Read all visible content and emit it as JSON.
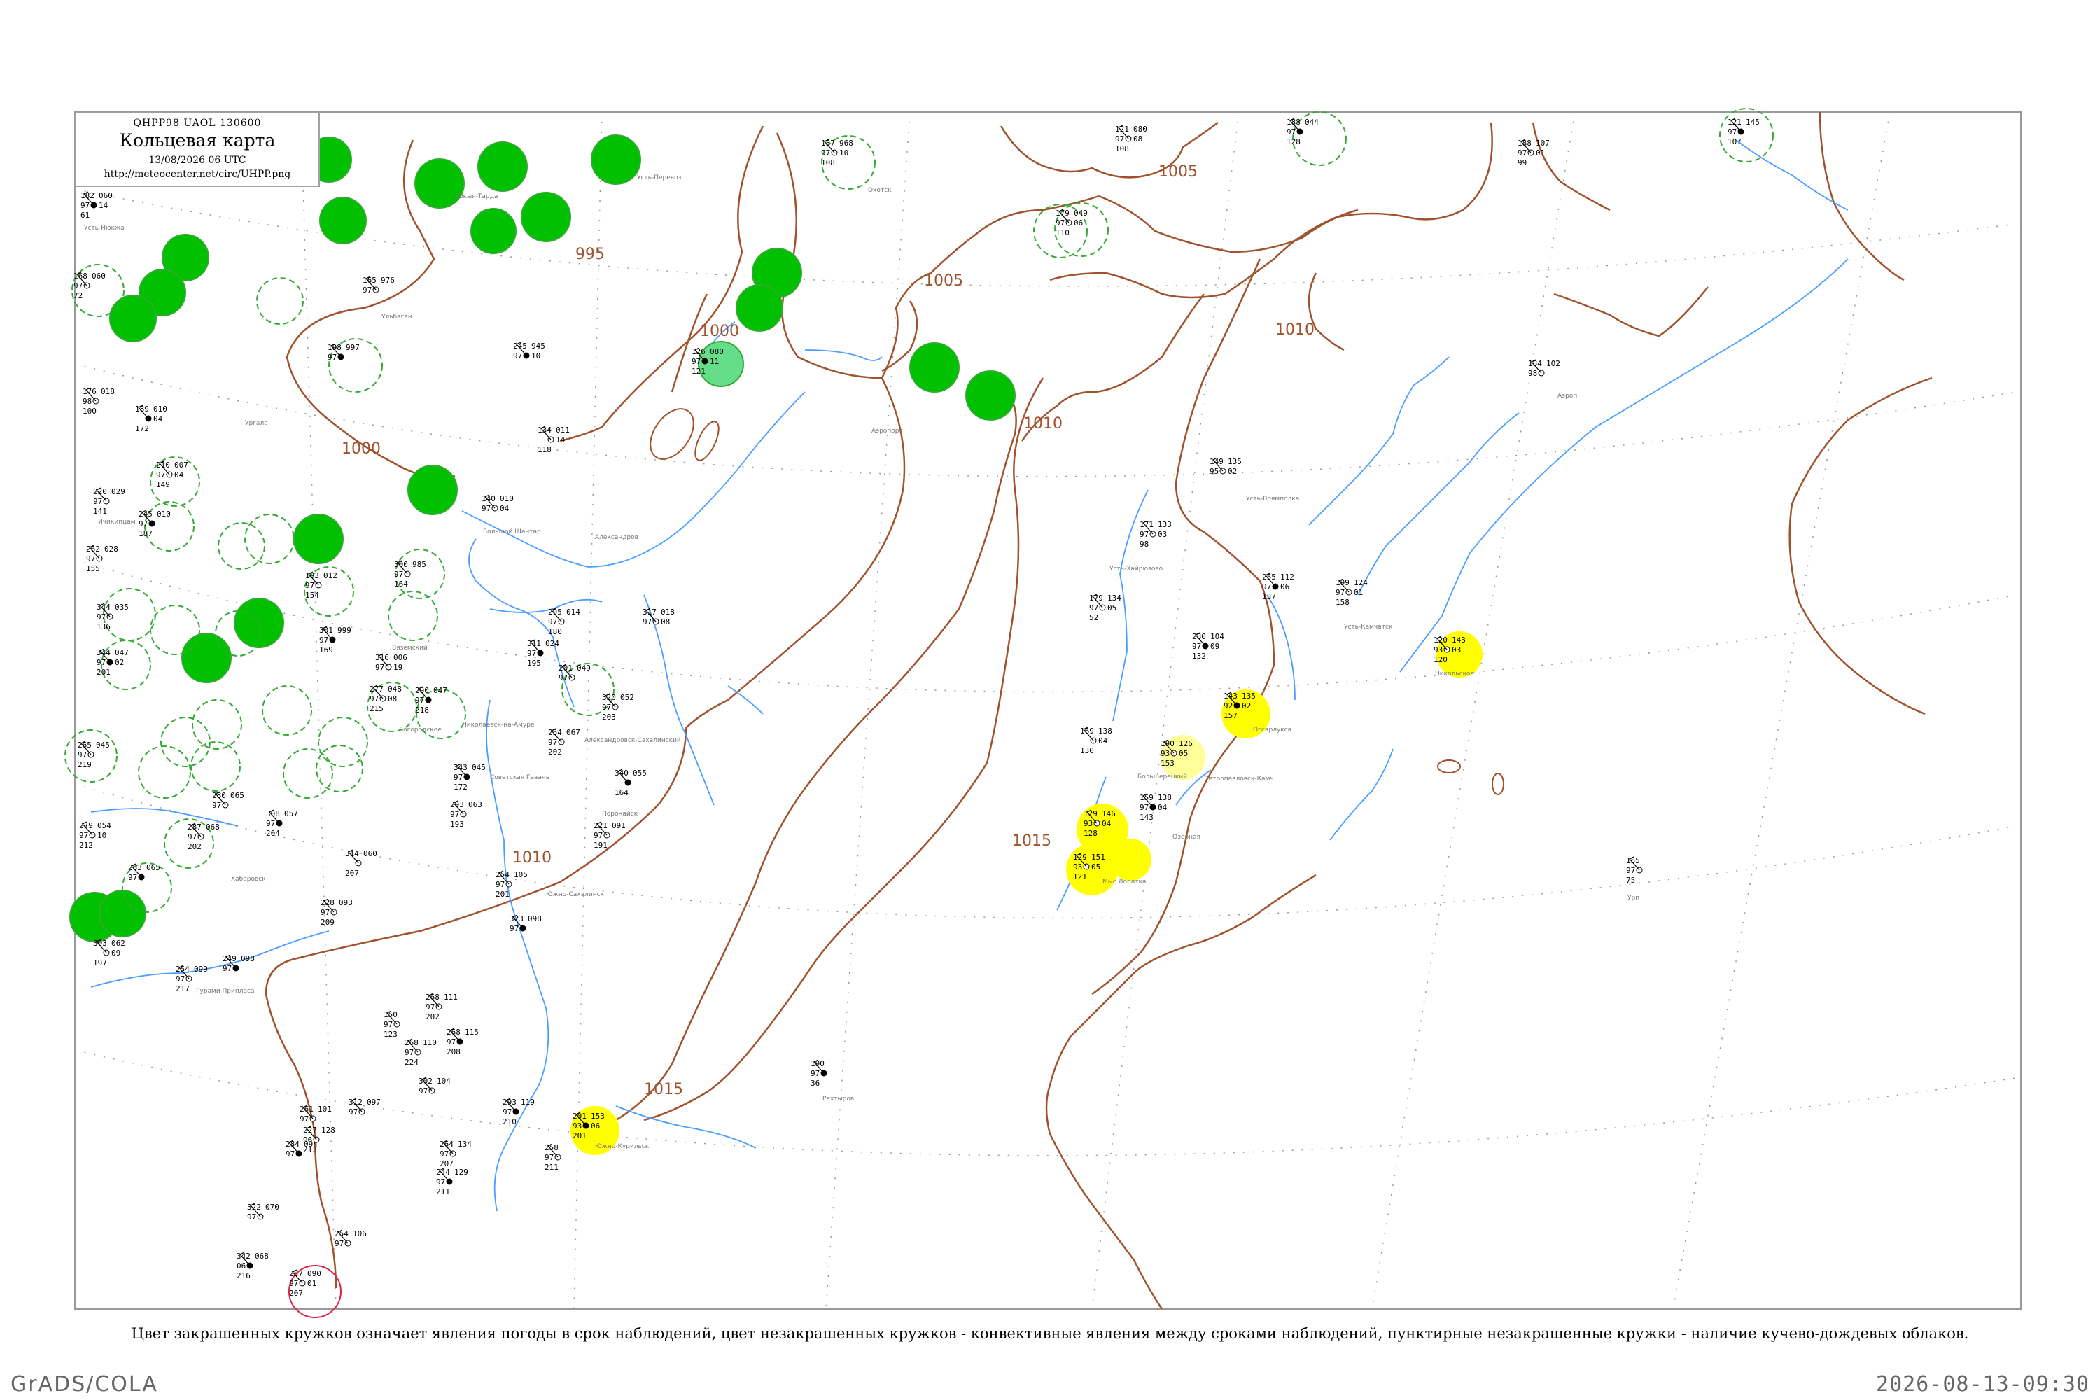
{
  "header": {
    "code": "QHPP98  UAOL  130600",
    "title": "Кольцевая карта",
    "datetime": "13/08/2026 06 UTC",
    "url": "http://meteocenter.net/circ/UHPP.png"
  },
  "caption": "Цвет закрашенных кружков означает явления погоды в срок наблюдений, цвет незакрашенных кружков - конвективные явления между сроками наблюдений, пунктирные незакрашенные кружки - наличие кучево-дождевых облаков.",
  "footer": {
    "left": "GrADS/COLA",
    "right": "2026-08-13-09:30"
  },
  "colors": {
    "rain_green": "#00c000",
    "shower_light_green": "#66dd88",
    "fog_yellow": "#ffff00",
    "haze_light_yellow": "#ffff99",
    "cb_dashed_green": "#33aa33",
    "thunder_red": "#dd2244",
    "coast": "#a0522d",
    "rivers": "#4a9eff",
    "isobar_label": "#a0522d"
  },
  "isobars": [
    "995",
    "1000",
    "1000",
    "1005",
    "1005",
    "1010",
    "1010",
    "1010",
    "1015",
    "1015"
  ],
  "stations": [
    {
      "p": "182",
      "t": "060",
      "dp": "14",
      "v": "97",
      "w": "61",
      "id": "",
      "name": ""
    },
    {
      "p": "168",
      "t": "060",
      "dp": "",
      "v": "97",
      "w": "72",
      "id": "",
      "name": ""
    },
    {
      "p": "176",
      "t": "018",
      "dp": "",
      "v": "98",
      "w": "100",
      "id": "",
      "name": ""
    },
    {
      "p": "189",
      "t": "010",
      "dp": "04",
      "v": "",
      "w": "172",
      "id": "",
      "name": ""
    },
    {
      "p": "210",
      "t": "007",
      "dp": "04",
      "v": "97",
      "w": "149",
      "id": "",
      "name": ""
    },
    {
      "p": "220",
      "t": "029",
      "dp": "",
      "v": "97",
      "w": "141",
      "id": "31442",
      "name": ""
    },
    {
      "p": "245",
      "t": "010",
      "dp": "",
      "v": "97",
      "w": "187",
      "id": "",
      "name": ""
    },
    {
      "p": "262",
      "t": "028",
      "dp": "",
      "v": "97",
      "w": "155",
      "id": "",
      "name": ""
    },
    {
      "p": "344",
      "t": "035",
      "dp": "",
      "v": "97",
      "w": "136",
      "id": "",
      "name": ""
    },
    {
      "p": "344",
      "t": "047",
      "dp": "02",
      "v": "97",
      "w": "201",
      "id": "",
      "name": ""
    },
    {
      "p": "265",
      "t": "045",
      "dp": "",
      "v": "97",
      "w": "219",
      "id": "",
      "name": ""
    },
    {
      "p": "279",
      "t": "054",
      "dp": "10",
      "v": "97",
      "w": "212",
      "id": "",
      "name": ""
    },
    {
      "p": "283",
      "t": "065",
      "dp": "",
      "v": "97",
      "w": "",
      "id": "",
      "name": ""
    },
    {
      "p": "303",
      "t": "062",
      "dp": "09",
      "v": "",
      "w": "197",
      "id": "",
      "name": ""
    },
    {
      "p": "254",
      "t": "099",
      "dp": "",
      "v": "97",
      "w": "217",
      "id": "",
      "name": ""
    },
    {
      "p": "249",
      "t": "098",
      "dp": "",
      "v": "97",
      "w": "",
      "id": "",
      "name": ""
    },
    {
      "p": "228",
      "t": "093",
      "dp": "",
      "v": "97",
      "w": "209",
      "id": "",
      "name": ""
    },
    {
      "p": "165",
      "t": "976",
      "dp": "",
      "v": "97",
      "w": "",
      "id": "",
      "name": ""
    },
    {
      "p": "198",
      "t": "997",
      "dp": "",
      "v": "97",
      "w": "",
      "id": "",
      "name": ""
    },
    {
      "p": "140",
      "t": "010",
      "dp": "04",
      "v": "97",
      "w": "",
      "id": "",
      "name": ""
    },
    {
      "p": "134",
      "t": "011",
      "dp": "14",
      "v": "",
      "w": "118",
      "id": "",
      "name": ""
    },
    {
      "p": "245",
      "t": "945",
      "dp": "10",
      "v": "97",
      "w": "",
      "id": "",
      "name": ""
    },
    {
      "p": "300",
      "t": "985",
      "dp": "",
      "v": "97",
      "w": "164",
      "id": "",
      "name": ""
    },
    {
      "p": "193",
      "t": "012",
      "dp": "",
      "v": "97",
      "w": "154",
      "id": "",
      "name": ""
    },
    {
      "p": "301",
      "t": "999",
      "dp": "",
      "v": "97",
      "w": "169",
      "id": "",
      "name": ""
    },
    {
      "p": "316",
      "t": "006",
      "dp": "19",
      "v": "97",
      "w": "",
      "id": "",
      "name": ""
    },
    {
      "p": "277",
      "t": "048",
      "dp": "08",
      "v": "97",
      "w": "215",
      "id": "",
      "name": ""
    },
    {
      "p": "290",
      "t": "047",
      "dp": "",
      "v": "97",
      "w": "218",
      "id": "",
      "name": ""
    },
    {
      "p": "295",
      "t": "014",
      "dp": "",
      "v": "97",
      "w": "180",
      "id": "",
      "name": ""
    },
    {
      "p": "317",
      "t": "018",
      "dp": "08",
      "v": "97",
      "w": "",
      "id": "",
      "name": ""
    },
    {
      "p": "311",
      "t": "024",
      "dp": "",
      "v": "97",
      "w": "195",
      "id": "",
      "name": ""
    },
    {
      "p": "320",
      "t": "052",
      "dp": "",
      "v": "97",
      "w": "203",
      "id": "",
      "name": ""
    },
    {
      "p": "254",
      "t": "067",
      "dp": "",
      "v": "97",
      "w": "202",
      "id": "",
      "name": ""
    },
    {
      "p": "343",
      "t": "045",
      "dp": "",
      "v": "97",
      "w": "172",
      "id": "",
      "name": ""
    },
    {
      "p": "293",
      "t": "063",
      "dp": "",
      "v": "97",
      "w": "193",
      "id": "",
      "name": ""
    },
    {
      "p": "280",
      "t": "065",
      "dp": "",
      "v": "97",
      "w": "",
      "id": "",
      "name": ""
    },
    {
      "p": "308",
      "t": "057",
      "dp": "",
      "v": "97",
      "w": "204",
      "id": "",
      "name": ""
    },
    {
      "p": "287",
      "t": "068",
      "dp": "",
      "v": "97",
      "w": "202",
      "id": "",
      "name": ""
    },
    {
      "p": "221",
      "t": "091",
      "dp": "",
      "v": "97",
      "w": "191",
      "id": "",
      "name": ""
    },
    {
      "p": "340",
      "t": "055",
      "dp": "",
      "v": "",
      "w": "164",
      "id": "",
      "name": ""
    },
    {
      "p": "314",
      "t": "060",
      "dp": "",
      "v": "",
      "w": "207",
      "id": "",
      "name": ""
    },
    {
      "p": "254",
      "t": "105",
      "dp": "",
      "v": "97",
      "w": "201",
      "id": "",
      "name": ""
    },
    {
      "p": "323",
      "t": "098",
      "dp": "",
      "v": "97",
      "w": "",
      "id": "",
      "name": ""
    },
    {
      "p": "268",
      "t": "111",
      "dp": "",
      "v": "97",
      "w": "202",
      "id": "",
      "name": ""
    },
    {
      "p": "150",
      "t": "",
      "dp": "",
      "v": "97",
      "w": "123",
      "id": "",
      "name": ""
    },
    {
      "p": "268",
      "t": "115",
      "dp": "",
      "v": "97",
      "w": "208",
      "id": "",
      "name": ""
    },
    {
      "p": "268",
      "t": "110",
      "dp": "",
      "v": "97",
      "w": "224",
      "id": "",
      "name": ""
    },
    {
      "p": "302",
      "t": "104",
      "dp": "",
      "v": "97",
      "w": "",
      "id": "",
      "name": ""
    },
    {
      "p": "293",
      "t": "119",
      "dp": "",
      "v": "97",
      "w": "210",
      "id": "",
      "name": ""
    },
    {
      "p": "261",
      "t": "101",
      "dp": "",
      "v": "97",
      "w": "",
      "id": "",
      "name": ""
    },
    {
      "p": "312",
      "t": "097",
      "dp": "",
      "v": "97",
      "w": "",
      "id": "",
      "name": ""
    },
    {
      "p": "284",
      "t": "094",
      "dp": "",
      "v": "97",
      "w": "",
      "id": "",
      "name": ""
    },
    {
      "p": "227",
      "t": "128",
      "dp": "",
      "v": "96",
      "w": "213",
      "id": "",
      "name": ""
    },
    {
      "p": "264",
      "t": "134",
      "dp": "",
      "v": "97",
      "w": "207",
      "id": "",
      "name": ""
    },
    {
      "p": "244",
      "t": "129",
      "dp": "",
      "v": "97",
      "w": "211",
      "id": "",
      "name": ""
    },
    {
      "p": "258",
      "t": "",
      "dp": "",
      "v": "97",
      "w": "211",
      "id": "",
      "name": ""
    },
    {
      "p": "322",
      "t": "070",
      "dp": "",
      "v": "97",
      "w": "",
      "id": "",
      "name": ""
    },
    {
      "p": "342",
      "t": "068",
      "dp": "",
      "v": "06",
      "w": "216",
      "id": "",
      "name": ""
    },
    {
      "p": "257",
      "t": "090",
      "dp": "01",
      "v": "97",
      "w": "207",
      "id": "",
      "name": ""
    },
    {
      "p": "254",
      "t": "106",
      "dp": "",
      "v": "97",
      "w": "",
      "id": "",
      "name": ""
    },
    {
      "p": "190",
      "t": "",
      "dp": "",
      "v": "97",
      "w": "36",
      "id": "",
      "name": ""
    },
    {
      "p": "187",
      "t": "968",
      "dp": "10",
      "v": "97",
      "w": "108",
      "id": "",
      "name": ""
    },
    {
      "p": "121",
      "t": "080",
      "dp": "08",
      "v": "97",
      "w": "108",
      "id": "",
      "name": ""
    },
    {
      "p": "188",
      "t": "044",
      "dp": "",
      "v": "97",
      "w": "128",
      "id": "",
      "name": ""
    },
    {
      "p": "179",
      "t": "049",
      "dp": "06",
      "v": "97",
      "w": "110",
      "id": "",
      "name": ""
    },
    {
      "p": "188",
      "t": "107",
      "dp": "01",
      "v": "97",
      "w": "99",
      "id": "",
      "name": ""
    },
    {
      "p": "121",
      "t": "145",
      "dp": "",
      "v": "97",
      "w": "107",
      "id": "",
      "name": ""
    },
    {
      "p": "149",
      "t": "135",
      "dp": "02",
      "v": "95",
      "w": "",
      "id": "",
      "name": ""
    },
    {
      "p": "171",
      "t": "133",
      "dp": "03",
      "v": "97",
      "w": "98",
      "id": "",
      "name": ""
    },
    {
      "p": "255",
      "t": "112",
      "dp": "06",
      "v": "97",
      "w": "137",
      "id": "",
      "name": ""
    },
    {
      "p": "199",
      "t": "124",
      "dp": "01",
      "v": "97",
      "w": "158",
      "id": "",
      "name": ""
    },
    {
      "p": "179",
      "t": "134",
      "dp": "05",
      "v": "97",
      "w": "52",
      "id": "",
      "name": ""
    },
    {
      "p": "280",
      "t": "104",
      "dp": "09",
      "v": "97",
      "w": "132",
      "id": "",
      "name": ""
    },
    {
      "p": "184",
      "t": "102",
      "dp": "",
      "v": "98",
      "w": "",
      "id": "",
      "name": ""
    },
    {
      "p": "169",
      "t": "138",
      "dp": "04",
      "v": "",
      "w": "130",
      "id": "",
      "name": ""
    },
    {
      "p": "159",
      "t": "138",
      "dp": "04",
      "v": "97",
      "w": "143",
      "id": "",
      "name": ""
    },
    {
      "p": "155",
      "t": "",
      "dp": "",
      "v": "97",
      "w": "75",
      "id": "",
      "name": ""
    },
    {
      "p": "201",
      "t": "049",
      "dp": "",
      "v": "97",
      "w": "",
      "id": "",
      "name": ""
    },
    {
      "p": "126",
      "t": "080",
      "dp": "11",
      "v": "97",
      "w": "121",
      "id": "",
      "name": ""
    },
    {
      "p": "190",
      "t": "126",
      "dp": "05",
      "v": "93",
      "w": "153",
      "id": "",
      "name": ""
    },
    {
      "p": "120",
      "t": "143",
      "dp": "03",
      "v": "93",
      "w": "120",
      "id": "",
      "name": ""
    },
    {
      "p": "143",
      "t": "135",
      "dp": "02",
      "v": "92",
      "w": "157",
      "id": "",
      "name": ""
    },
    {
      "p": "129",
      "t": "146",
      "dp": "04",
      "v": "93",
      "w": "128",
      "id": "",
      "name": ""
    },
    {
      "p": "129",
      "t": "151",
      "dp": "05",
      "v": "93",
      "w": "121",
      "id": "",
      "name": ""
    },
    {
      "p": "201",
      "t": "153",
      "dp": "06",
      "v": "93",
      "w": "201",
      "id": "",
      "name": ""
    }
  ]
}
